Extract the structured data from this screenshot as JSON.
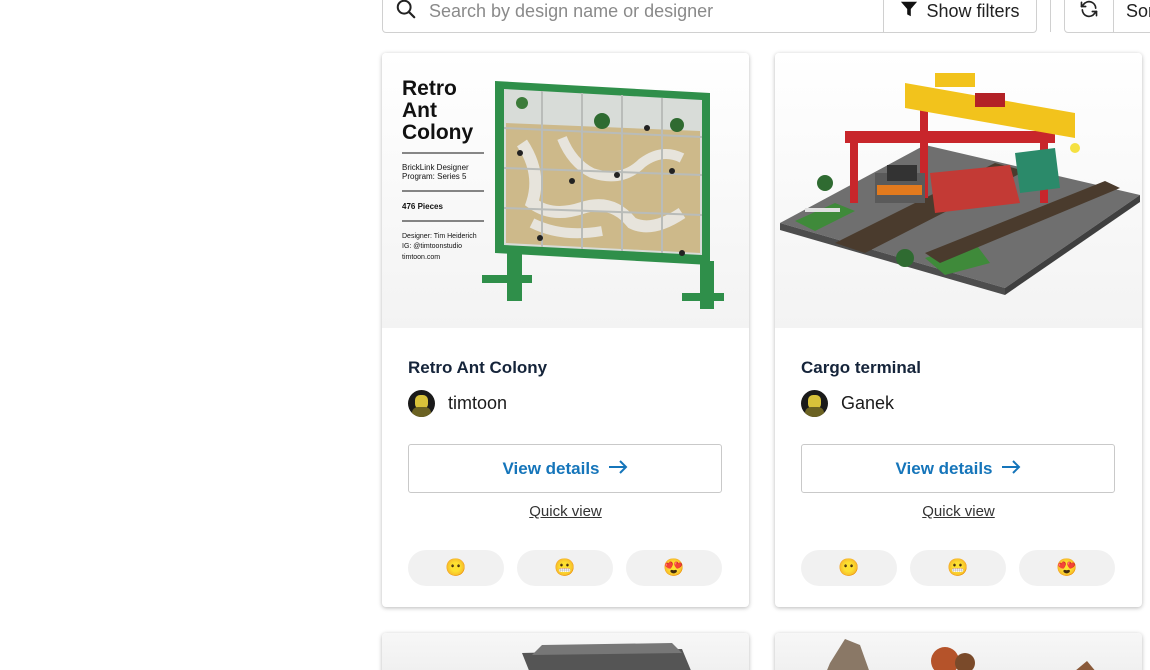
{
  "toolbar": {
    "search_placeholder": "Search by design name or designer",
    "filters_label": "Show filters",
    "sort_label": "Sort"
  },
  "cards": [
    {
      "title": "Retro Ant Colony",
      "designer": "timtoon",
      "details_label": "View details",
      "quick_view_label": "Quick view",
      "image": {
        "poster_title_line1": "Retro",
        "poster_title_line2": "Ant",
        "poster_title_line3": "Colony",
        "poster_program_line1": "BrickLink Designer",
        "poster_program_line2": "Program: Series 5",
        "poster_pieces": "476 Pieces",
        "poster_designer": "Designer: Tim Heiderich",
        "poster_ig": "IG: @timtoonstudio",
        "poster_site": "timtoon.com"
      },
      "reactions": [
        "😶",
        "😬",
        "😍"
      ]
    },
    {
      "title": "Cargo terminal",
      "designer": "Ganek",
      "details_label": "View details",
      "quick_view_label": "Quick view",
      "reactions": [
        "😶",
        "😬",
        "😍"
      ]
    }
  ],
  "colors": {
    "accent": "#1575ba",
    "title": "#15243a",
    "reaction_bg": "#f1f1f1"
  },
  "icons": [
    "search-icon",
    "filter-icon",
    "refresh-icon",
    "arrow-right-icon"
  ]
}
